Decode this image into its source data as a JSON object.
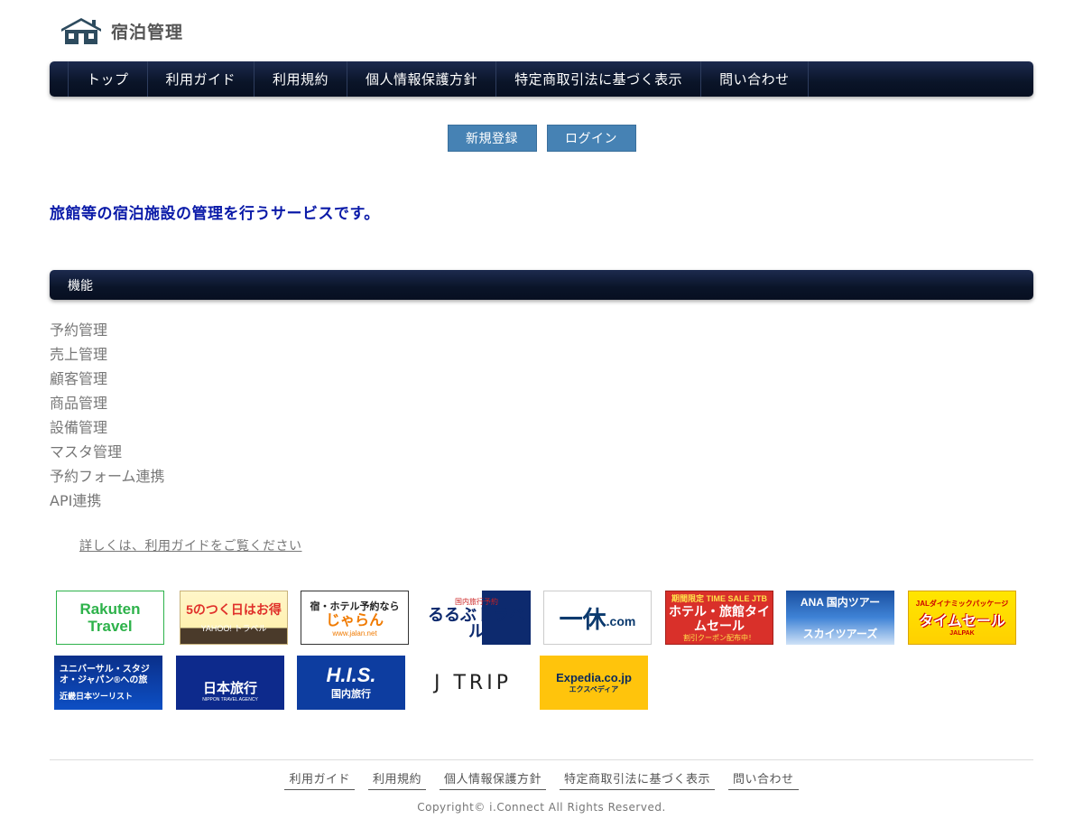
{
  "header": {
    "title": "宿泊管理",
    "logo_icon": "house-logo-icon"
  },
  "nav": {
    "items": [
      "トップ",
      "利用ガイド",
      "利用規約",
      "個人情報保護方針",
      "特定商取引法に基づく表示",
      "問い合わせ"
    ]
  },
  "auth": {
    "register_label": "新規登録",
    "login_label": "ログイン"
  },
  "tagline": "旅館等の宿泊施設の管理を行うサービスです。",
  "features": {
    "title": "機能",
    "items": [
      "予約管理",
      "売上管理",
      "顧客管理",
      "商品管理",
      "設備管理",
      "マスタ管理",
      "予約フォーム連携",
      "API連携"
    ],
    "guide_link": "詳しくは、利用ガイドをご覧ください"
  },
  "banners": {
    "rakuten": {
      "line1": "Rakuten",
      "line2": "Travel"
    },
    "yahoo": {
      "line1": "5のつく日はお得",
      "line2": "YAHOO! トラベル"
    },
    "jalan": {
      "line1": "宿・ホテル予約なら",
      "line2": "じゃらん",
      "line3": "www.jalan.net"
    },
    "rurubu": {
      "line1": "国内旅行予約",
      "line2": "るるぶトラベル"
    },
    "ikyu": {
      "line1": "一休",
      "line2": ".com"
    },
    "jtb": {
      "line1": "期間限定 TIME SALE JTB",
      "line2": "ホテル・旅館タイムセール",
      "line3": "割引クーポン配布中！"
    },
    "ana": {
      "line1": "ANA 国内ツアー",
      "line2": "スカイツアーズ"
    },
    "jal": {
      "line1": "JALダイナミックパッケージ",
      "line2": "タイムセール",
      "line3": "JALPAK"
    },
    "usj": {
      "line1": "ユニバーサル・スタジオ・ジャパン®への旅",
      "line2": "近畿日本ツーリスト"
    },
    "nta": {
      "line1": "日本旅行",
      "line2": "NIPPON TRAVEL AGENCY"
    },
    "his": {
      "line1": "H.I.S.",
      "line2": "国内旅行"
    },
    "jtrip": {
      "line1": "J TRIP"
    },
    "expedia": {
      "line1": "Expedia.co.jp",
      "line2": "エクスペディア"
    }
  },
  "footer": {
    "links": [
      "利用ガイド",
      "利用規約",
      "個人情報保護方針",
      "特定商取引法に基づく表示",
      "問い合わせ"
    ],
    "copyright": "Copyright© i.Connect All Rights Reserved."
  },
  "colors": {
    "nav_bg": "#0a1428",
    "button_bg": "#4682b4",
    "tagline": "#0a1aa8"
  }
}
